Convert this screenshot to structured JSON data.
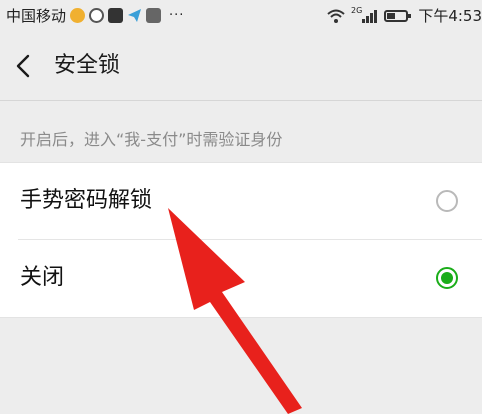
{
  "status_bar": {
    "carrier": "中国移动",
    "more": "···",
    "network": "2G",
    "time": "下午4:53"
  },
  "header": {
    "title": "安全锁"
  },
  "section_note": "开启后，进入“我-支付”时需验证身份",
  "options": [
    {
      "label": "手势密码解锁",
      "selected": false
    },
    {
      "label": "关闭",
      "selected": true
    }
  ],
  "colors": {
    "accent": "#1aad19",
    "annotation_arrow": "#e8211c",
    "background": "#ededed"
  }
}
